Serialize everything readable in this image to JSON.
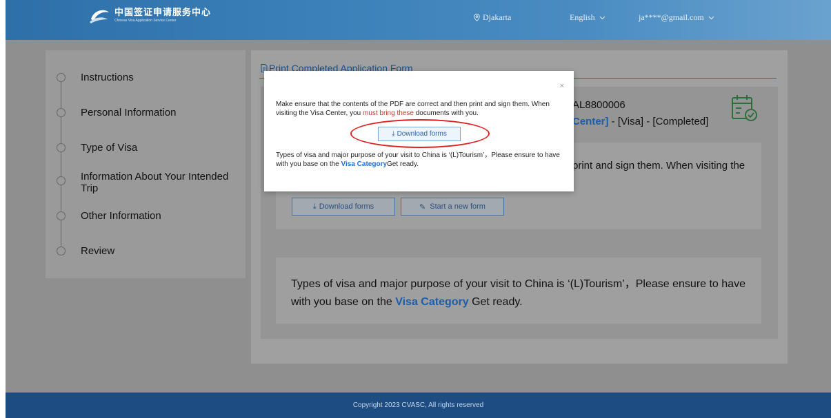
{
  "header": {
    "logo_cn": "中国签证申请服务中心",
    "logo_en": "Chinese Visa Application Service Center",
    "location": "Djakarta",
    "language": "English",
    "account": "ja****@gmail.com"
  },
  "sidebar": {
    "steps": [
      {
        "label": "Instructions"
      },
      {
        "label": "Personal Information"
      },
      {
        "label": "Type of Visa"
      },
      {
        "label": "Information About Your Intended Trip"
      },
      {
        "label": "Other Information"
      },
      {
        "label": "Review"
      }
    ]
  },
  "main": {
    "title": "Print Completed Application Form",
    "reference_partial": "AL8800006",
    "status_center_partial": "Center]",
    "status_rest": " - [Visa] - [Completed]",
    "box2_text_partial": "print and sign them. When visiting the",
    "download_label": "Download forms",
    "new_form_label": "Start a new form",
    "visa_info_pre": "Types of visa and major purpose of your visit to China is ‘(L)Tourism’，Please ensure to have with you base on the ",
    "visa_category_link": "Visa Category",
    "visa_info_post": " Get ready."
  },
  "modal": {
    "close": "×",
    "p1_a": "Make ensure that the contents of the PDF are correct and then print and sign them. When visiting the Visa Center, you ",
    "p1_strike": "must bring these",
    "p1_b": " documents with you.",
    "download_label": "Download forms",
    "p2_a": "Types of visa and major purpose of your visit to China is ‘(L)Tourism’，Please ensure to have with you base on the ",
    "p2_link": "Visa Category",
    "p2_b": "Get ready."
  },
  "footer": {
    "copyright": "Copyright 2023 CVASC, All rights reserved"
  },
  "colors": {
    "header": "#3a7fb8",
    "footer": "#1c4c82",
    "link": "#1f6fd1",
    "highlight_oval": "#e02020"
  }
}
